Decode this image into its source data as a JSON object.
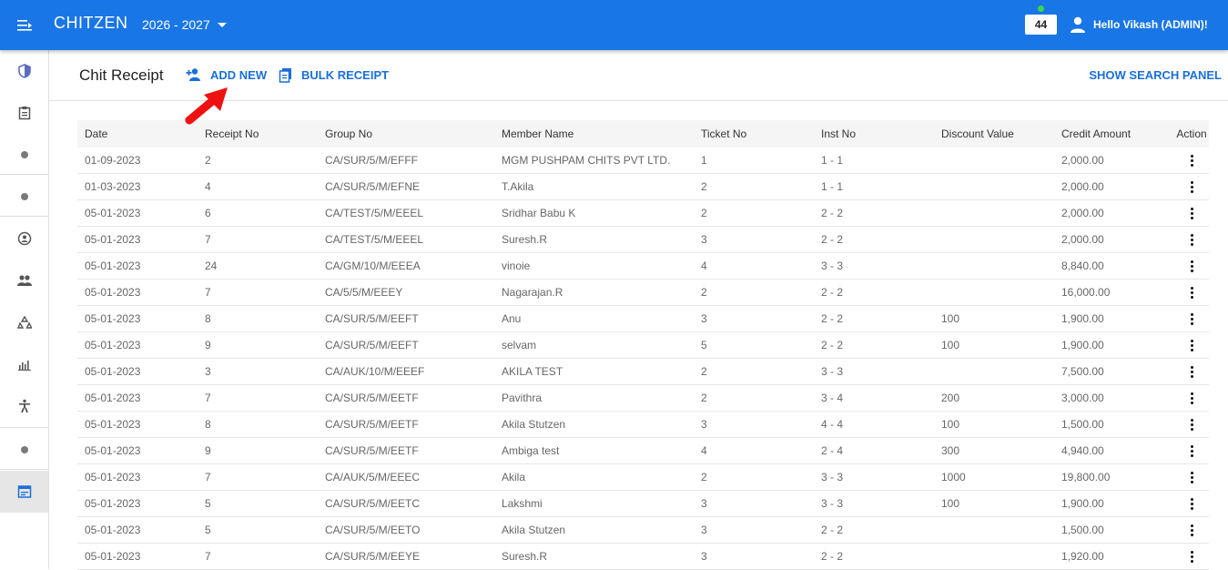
{
  "app": {
    "brand": "CHITZEN",
    "year": "2026 - 2027"
  },
  "header": {
    "notification_count": "44",
    "user_greeting": "Hello Vikash (ADMIN)!"
  },
  "page": {
    "title": "Chit Receipt",
    "add_new_label": "ADD NEW",
    "bulk_receipt_label": "BULK RECEIPT",
    "show_search_label": "SHOW SEARCH PANEL"
  },
  "colors": {
    "primary": "#1976e6",
    "link": "#1a6fd8",
    "arrow": "#ee1111"
  },
  "sidebar_icons": [
    "shield-icon",
    "clipboard-icon",
    "dot-icon",
    "dot-icon",
    "account-circle-icon",
    "people-icon",
    "recycle-icon",
    "bar-chart-icon",
    "accessibility-icon",
    "dot-icon",
    "receipt-table-icon"
  ],
  "table": {
    "columns": [
      "Date",
      "Receipt No",
      "Group No",
      "Member Name",
      "Ticket No",
      "Inst No",
      "Discount Value",
      "Credit Amount",
      "Action"
    ],
    "rows": [
      [
        "01-09-2023",
        "2",
        "CA/SUR/5/M/EFFF",
        "MGM PUSHPAM CHITS PVT LTD.",
        "1",
        "1 - 1",
        "",
        "2,000.00"
      ],
      [
        "01-03-2023",
        "4",
        "CA/SUR/5/M/EFNE",
        "T.Akila",
        "2",
        "1 - 1",
        "",
        "2,000.00"
      ],
      [
        "05-01-2023",
        "6",
        "CA/TEST/5/M/EEEL",
        "Sridhar Babu K",
        "2",
        "2 - 2",
        "",
        "2,000.00"
      ],
      [
        "05-01-2023",
        "7",
        "CA/TEST/5/M/EEEL",
        "Suresh.R",
        "3",
        "2 - 2",
        "",
        "2,000.00"
      ],
      [
        "05-01-2023",
        "24",
        "CA/GM/10/M/EEEA",
        "vinoie",
        "4",
        "3 - 3",
        "",
        "8,840.00"
      ],
      [
        "05-01-2023",
        "7",
        "CA/5/5/M/EEEY",
        "Nagarajan.R",
        "2",
        "2 - 2",
        "",
        "16,000.00"
      ],
      [
        "05-01-2023",
        "8",
        "CA/SUR/5/M/EEFT",
        "Anu",
        "3",
        "2 - 2",
        "100",
        "1,900.00"
      ],
      [
        "05-01-2023",
        "9",
        "CA/SUR/5/M/EEFT",
        "selvam",
        "5",
        "2 - 2",
        "100",
        "1,900.00"
      ],
      [
        "05-01-2023",
        "3",
        "CA/AUK/10/M/EEEF",
        "AKILA TEST",
        "2",
        "3 - 3",
        "",
        "7,500.00"
      ],
      [
        "05-01-2023",
        "7",
        "CA/SUR/5/M/EETF",
        "Pavithra",
        "2",
        "3 - 4",
        "200",
        "3,000.00"
      ],
      [
        "05-01-2023",
        "8",
        "CA/SUR/5/M/EETF",
        "Akila Stutzen",
        "3",
        "4 - 4",
        "100",
        "1,500.00"
      ],
      [
        "05-01-2023",
        "9",
        "CA/SUR/5/M/EETF",
        "Ambiga test",
        "4",
        "2 - 4",
        "300",
        "4,940.00"
      ],
      [
        "05-01-2023",
        "7",
        "CA/AUK/5/M/EEEC",
        "Akila",
        "2",
        "3 - 3",
        "1000",
        "19,800.00"
      ],
      [
        "05-01-2023",
        "5",
        "CA/SUR/5/M/EETC",
        "Lakshmi",
        "3",
        "3 - 3",
        "100",
        "1,900.00"
      ],
      [
        "05-01-2023",
        "5",
        "CA/SUR/5/M/EETO",
        "Akila Stutzen",
        "3",
        "2 - 2",
        "",
        "1,500.00"
      ],
      [
        "05-01-2023",
        "7",
        "CA/SUR/5/M/EEYE",
        "Suresh.R",
        "3",
        "2 - 2",
        "",
        "1,920.00"
      ]
    ]
  }
}
